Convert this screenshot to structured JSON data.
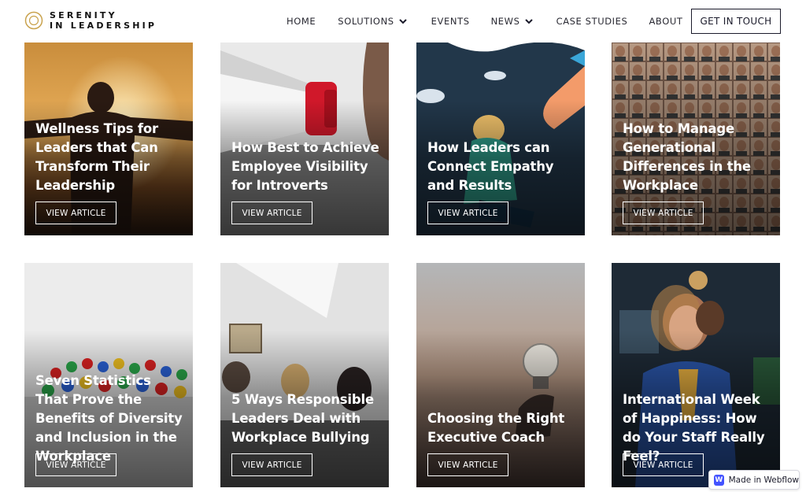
{
  "brand": {
    "line1": "SERENITY",
    "line2": "IN LEADERSHIP",
    "accent_color": "#c9a24c"
  },
  "nav": {
    "items": [
      {
        "label": "HOME",
        "dropdown": false
      },
      {
        "label": "SOLUTIONS",
        "dropdown": true
      },
      {
        "label": "EVENTS",
        "dropdown": false
      },
      {
        "label": "NEWS",
        "dropdown": true
      },
      {
        "label": "CASE STUDIES",
        "dropdown": false
      },
      {
        "label": "ABOUT",
        "dropdown": false
      }
    ],
    "cta_label": "GET IN TOUCH"
  },
  "articles": [
    {
      "title": "Wellness Tips for Leaders that Can Transform Their Leadership",
      "button": "VIEW ARTICLE",
      "image": "silhouette-sunset"
    },
    {
      "title": "How Best to Achieve Employee Visibility for Introverts",
      "button": "VIEW ARTICLE",
      "image": "megaphone"
    },
    {
      "title": "How Leaders can Connect Empathy and Results",
      "button": "VIEW ARTICLE",
      "image": "illustration-reaching-hand"
    },
    {
      "title": "How to Manage Generational Differences in the Workplace",
      "button": "VIEW ARTICLE",
      "image": "faces-grid"
    },
    {
      "title": "Seven Statistics That Prove the Benefits of Diversity and Inclusion in the Workplace",
      "button": "VIEW ARTICLE",
      "image": "colored-pawns"
    },
    {
      "title": "5 Ways Responsible Leaders Deal with Workplace Bullying",
      "button": "VIEW ARTICLE",
      "image": "office-meeting"
    },
    {
      "title": "Choosing the Right Executive Coach",
      "button": "VIEW ARTICLE",
      "image": "lightbulb-sky"
    },
    {
      "title": "International Week of Happiness: How do Your Staff Really Feel?",
      "button": "VIEW ARTICLE",
      "image": "smiling-woman-office"
    }
  ],
  "badge": {
    "label": "Made in Webflow",
    "icon": "W",
    "color": "#4353ff"
  }
}
